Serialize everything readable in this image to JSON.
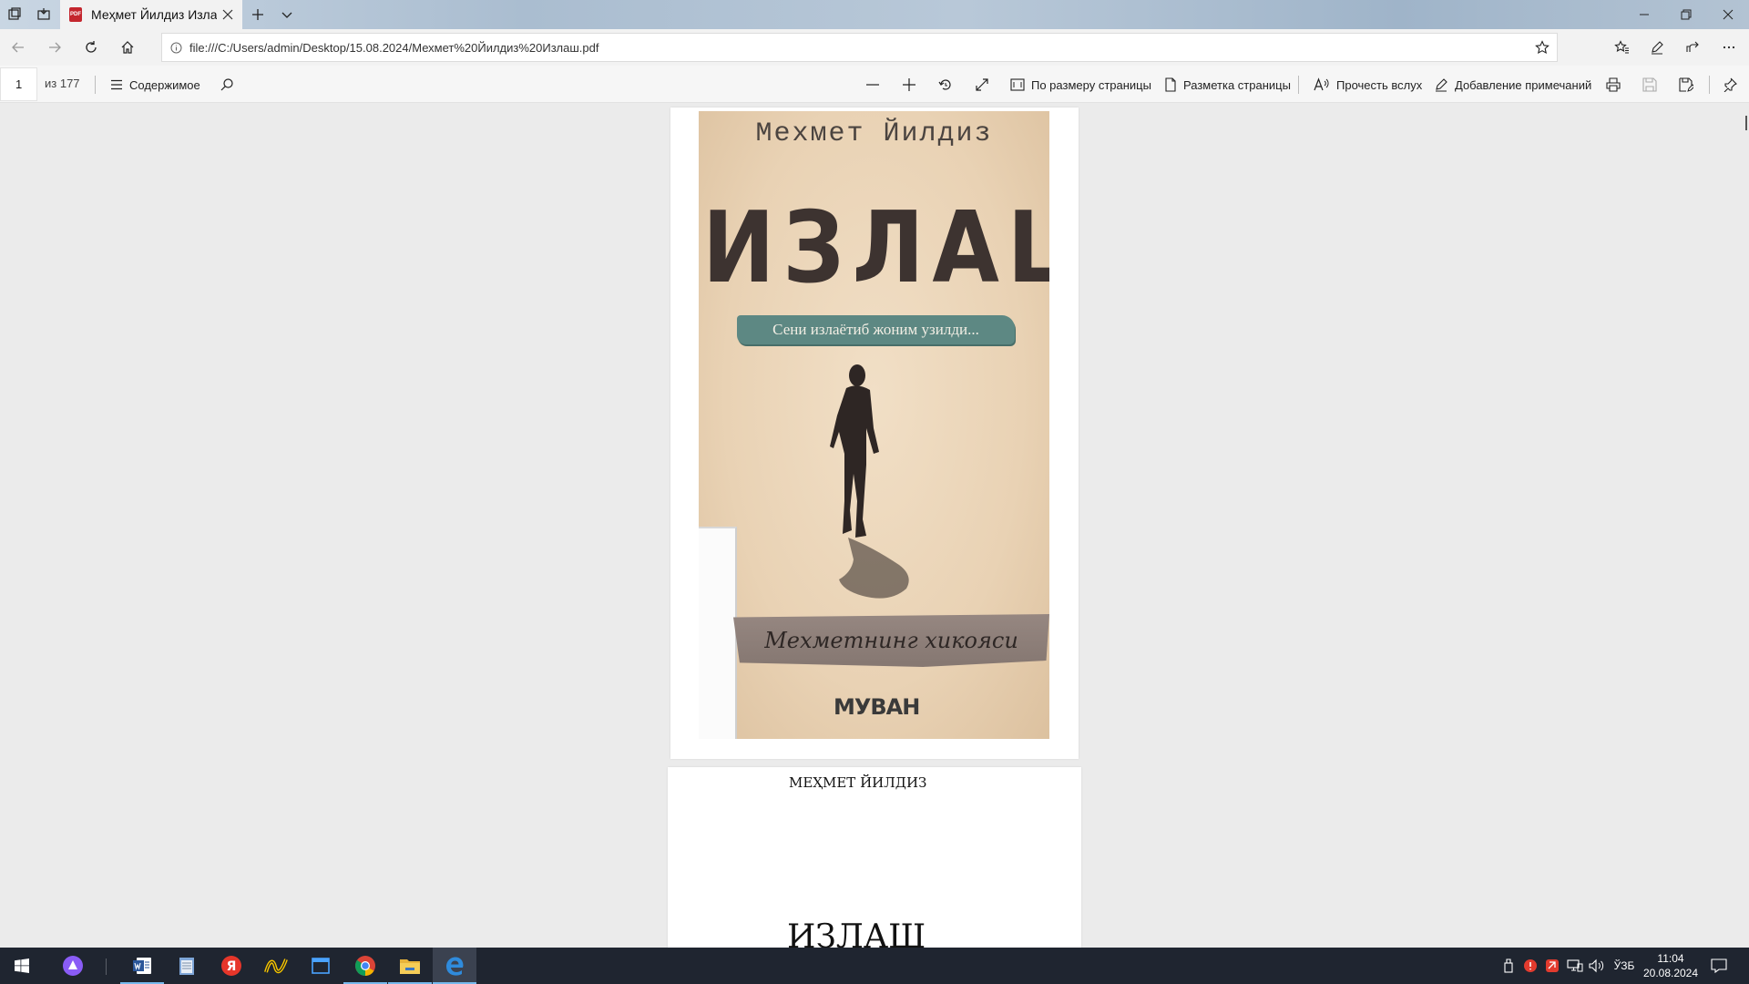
{
  "browser": {
    "tab": {
      "title": "Меҳмет Йилдиз Излаш",
      "favicon": "PDF"
    },
    "address": {
      "url": "file:///C:/Users/admin/Desktop/15.08.2024/Мехмет%20Йилдиз%20Излаш.pdf"
    }
  },
  "pdf_toolbar": {
    "page_current": "1",
    "page_total": "из 177",
    "contents_label": "Содержимое",
    "fit_page_label": "По размеру страницы",
    "page_layout_label": "Разметка страницы",
    "read_aloud_label": "Прочесть вслух",
    "add_notes_label": "Добавление примечаний"
  },
  "document": {
    "cover": {
      "author": "Мехмет Йилдиз",
      "title": "ИЗЛАШ",
      "tagline": "Сени излаётиб жоним узилди...",
      "subtitle": "Мехметнинг хикояси",
      "publisher": "МУВАН"
    },
    "page2": {
      "author": "МЕҲМЕТ ЙИЛДИЗ",
      "title": "ИЗЛАШ"
    }
  },
  "taskbar": {
    "apps": [
      "alice-icon",
      "word-icon",
      "notepad-icon",
      "yandex-icon",
      "beeline-icon",
      "window-icon",
      "chrome-icon",
      "explorer-icon",
      "edge-icon"
    ],
    "language": "ЎЗБ",
    "time": "11:04",
    "date": "20.08.2024"
  },
  "colors": {
    "cover_background": "#e9d2b4",
    "cover_banner": "#5d8883",
    "taskbar": "#1f2530",
    "taskbar_active": "#76b9ed"
  }
}
